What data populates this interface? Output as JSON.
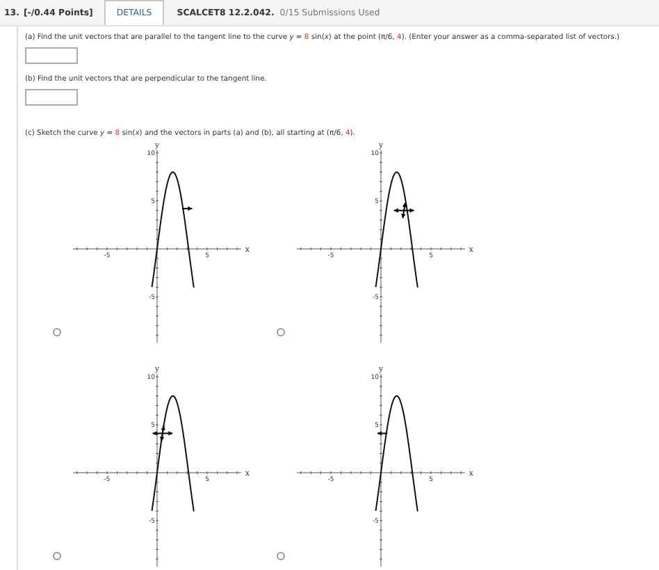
{
  "header": {
    "number": "13.",
    "points": "[-/0.44 Points]",
    "details_tab": "DETAILS",
    "code": "SCALCET8 12.2.042.",
    "submissions": "0/15 Submissions Used"
  },
  "parts": [
    {
      "kind": "answer",
      "text": [
        {
          "text": "(a) Find the unit vectors that are parallel to the tangent line to the curve  *y* = ",
          "highlight": false
        },
        {
          "text": "8",
          "highlight": true
        },
        {
          "text": " sin(*x*)  at the point (π/6, ",
          "highlight": false
        },
        {
          "text": "4",
          "highlight": true
        },
        {
          "text": "). (Enter your answer as a comma-separated list of vectors.)",
          "highlight": false
        }
      ]
    },
    {
      "kind": "answer",
      "text": [
        {
          "text": "(b) Find the unit vectors that are perpendicular to the tangent line.",
          "highlight": false
        }
      ]
    },
    {
      "kind": "sketch",
      "text": [
        {
          "text": "(c) Sketch the curve  *y* = ",
          "highlight": false
        },
        {
          "text": "8",
          "highlight": true
        },
        {
          "text": " sin(*x*)  and the vectors in parts (a) and (b), all starting at (π/6, ",
          "highlight": false
        },
        {
          "text": "4",
          "highlight": true
        },
        {
          "text": ").",
          "highlight": false
        }
      ],
      "options": [
        {
          "kind": "forward-arrow",
          "selected": false,
          "x_axis_label": "x",
          "y_axis_label": "y",
          "x_tick_labels": [
            "-5",
            "5"
          ],
          "y_tick_labels": [
            "10",
            "5",
            "-5"
          ]
        },
        {
          "kind": "cross-right",
          "selected": false,
          "x_axis_label": "x",
          "y_axis_label": "y",
          "x_tick_labels": [
            "-5",
            "5"
          ],
          "y_tick_labels": [
            "10",
            "5",
            "-5"
          ]
        },
        {
          "kind": "cross-left",
          "selected": false,
          "x_axis_label": "x",
          "y_axis_label": "y",
          "x_tick_labels": [
            "-5",
            "5"
          ],
          "y_tick_labels": [
            "10",
            "5",
            "-5"
          ]
        },
        {
          "kind": "backward-arrow",
          "selected": false,
          "x_axis_label": "x",
          "y_axis_label": "y",
          "x_tick_labels": [
            "-5",
            "5"
          ],
          "y_tick_labels": [
            "10",
            "5",
            "-5"
          ]
        }
      ]
    }
  ]
}
